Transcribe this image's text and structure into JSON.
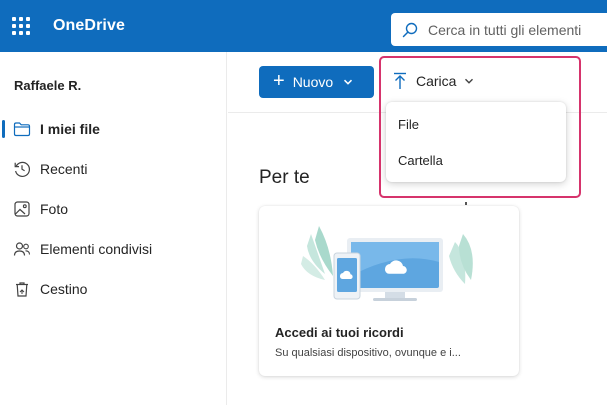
{
  "app": {
    "title": "OneDrive"
  },
  "search": {
    "placeholder": "Cerca in tutti gli elementi"
  },
  "sidebar": {
    "user": "Raffaele R.",
    "items": [
      {
        "label": "I miei file",
        "icon": "folder-icon",
        "active": true
      },
      {
        "label": "Recenti",
        "icon": "clock-icon",
        "active": false
      },
      {
        "label": "Foto",
        "icon": "image-icon",
        "active": false
      },
      {
        "label": "Elementi condivisi",
        "icon": "people-icon",
        "active": false
      },
      {
        "label": "Cestino",
        "icon": "trash-icon",
        "active": false
      }
    ]
  },
  "toolbar": {
    "new_label": "Nuovo",
    "upload_label": "Carica"
  },
  "upload_menu": {
    "items": [
      {
        "label": "File"
      },
      {
        "label": "Cartella"
      }
    ]
  },
  "main": {
    "section_title": "Per te",
    "card": {
      "title": "Accedi ai tuoi ricordi",
      "description": "Su qualsiasi dispositivo, ovunque e i..."
    }
  },
  "colors": {
    "brand": "#0f6cbd",
    "highlight": "#d6336c"
  }
}
